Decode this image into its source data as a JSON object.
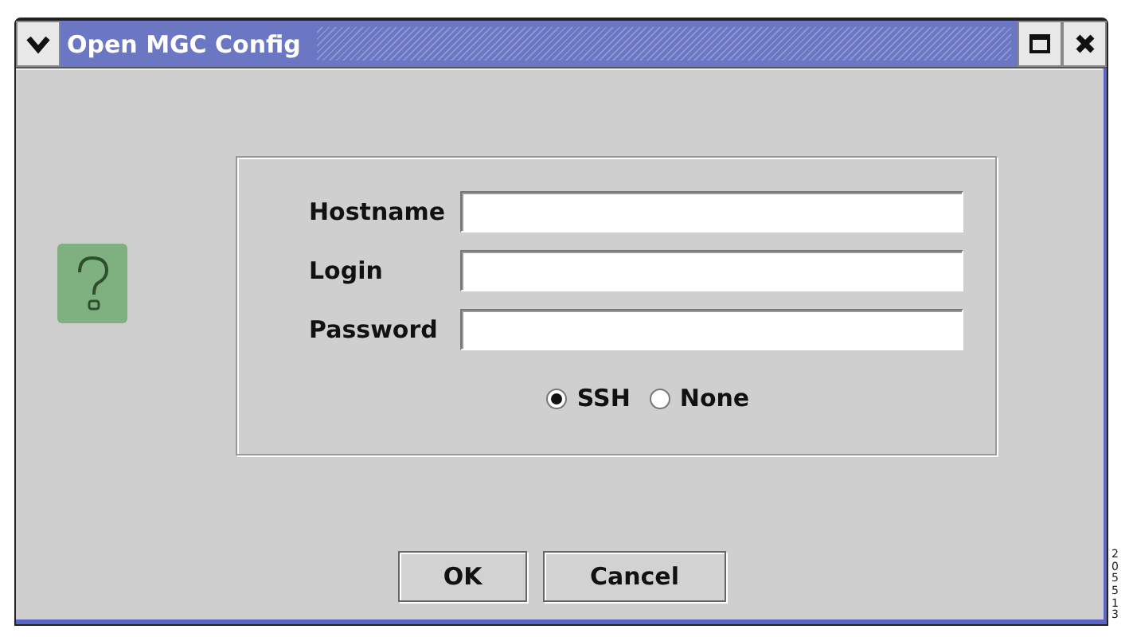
{
  "window": {
    "title": "Open MGC Config"
  },
  "fields": [
    {
      "label": "Hostname"
    },
    {
      "label": "Login"
    },
    {
      "label": "Password"
    }
  ],
  "connection": [
    {
      "label": "SSH",
      "selected": true
    },
    {
      "label": "None",
      "selected": false
    }
  ],
  "buttons": [
    "OK",
    "Cancel"
  ],
  "figure_number": "205513"
}
